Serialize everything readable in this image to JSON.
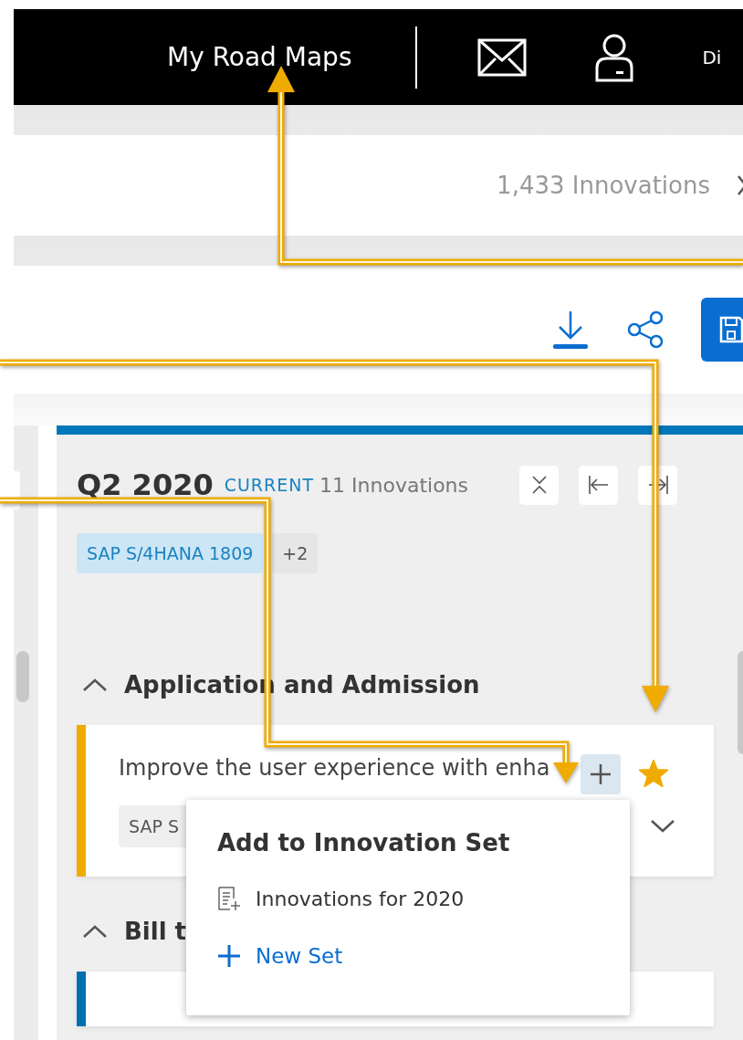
{
  "header": {
    "title": "My Road Maps",
    "user": "Di"
  },
  "summary": {
    "count": "1,433 Innovations"
  },
  "column": {
    "title": "Q2 2020",
    "badge": "CURRENT",
    "count": "11 Innovations",
    "tags": [
      {
        "label": "SAP S/4HANA 1809",
        "kind": "release"
      },
      {
        "label": "+2",
        "kind": "more"
      }
    ],
    "sections": [
      {
        "title": "Application and Admission",
        "expanded": true,
        "cards": [
          {
            "color": "#f0ab00",
            "description": "Improve the user experience with enha",
            "tag": "SAP S",
            "favorite": true
          }
        ]
      },
      {
        "title": "Bill t",
        "expanded": true,
        "cards": [
          {
            "color": "#0070b1"
          }
        ]
      }
    ]
  },
  "popover": {
    "title": "Add to Innovation Set",
    "items": [
      {
        "label": "Innovations for 2020",
        "kind": "set"
      },
      {
        "label": "New Set",
        "kind": "new"
      }
    ]
  }
}
